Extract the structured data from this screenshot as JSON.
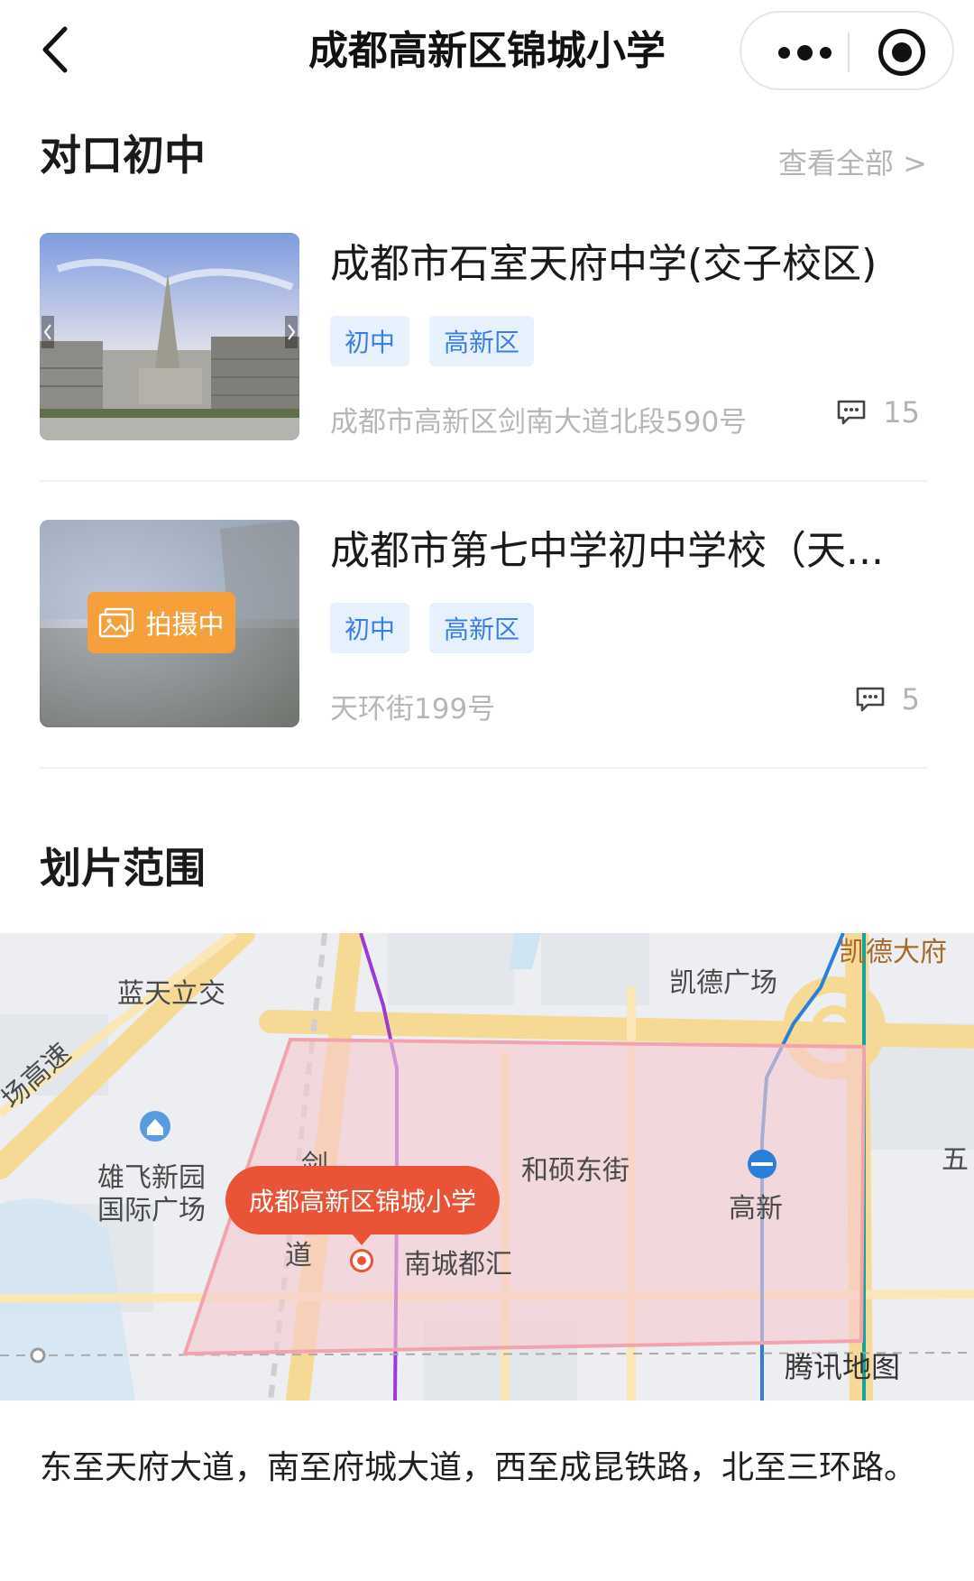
{
  "nav": {
    "title": "成都高新区锦城小学"
  },
  "matching_section": {
    "title": "对口初中",
    "see_all": "查看全部 >"
  },
  "schools": [
    {
      "name": "成都市石室天府中学(交子校区)",
      "tags": [
        "初中",
        "高新区"
      ],
      "address": "成都市高新区剑南大道北段590号",
      "comments": "15",
      "photo_status": ""
    },
    {
      "name": "成都市第七中学初中学校（天...",
      "tags": [
        "初中",
        "高新区"
      ],
      "address": "天环街199号",
      "comments": "5",
      "photo_status": "拍摄中"
    }
  ],
  "range_section": {
    "title": "划片范围",
    "description": "东至天府大道，南至府城大道，西至成昆铁路，北至三环路。"
  },
  "map": {
    "pin_label": "成都高新区锦城小学",
    "labels": {
      "lantian": "蓝天立交",
      "kaide_dafu": "凯德大府",
      "kaide_square": "凯德广场",
      "expressway": "场高速",
      "xiongfei_1": "雄飞新园",
      "xiongfei_2": "国际广场",
      "jian": "剑",
      "dao": "道",
      "heshuo": "和硕东街",
      "nancheng": "南城都汇",
      "gaoxin": "高新",
      "wu": "五"
    },
    "logo": "腾讯地图",
    "colors": {
      "region_fill": "#f6c9cf",
      "region_stroke": "#f2a4ae",
      "road_major": "#f7d996",
      "metro_purple": "#9a3bd6",
      "metro_blue": "#2b7fd8",
      "pin": "#ea5436"
    }
  }
}
